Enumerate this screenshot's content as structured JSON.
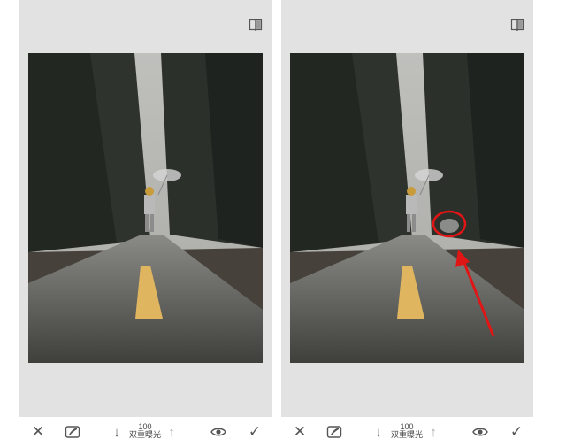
{
  "toolbar": {
    "value": "100",
    "label": "双重曝光",
    "close_glyph": "✕",
    "down_glyph": "↓",
    "up_glyph": "↑",
    "check_glyph": "✓"
  },
  "icons": {
    "compare": "compare-icon",
    "close": "close-icon",
    "brush": "brush-icon",
    "down": "arrow-down-icon",
    "up": "arrow-up-icon",
    "eye": "eye-icon",
    "check": "check-icon"
  },
  "colors": {
    "panel_bg": "#e2e2e2",
    "annotation_red": "#e01515"
  }
}
